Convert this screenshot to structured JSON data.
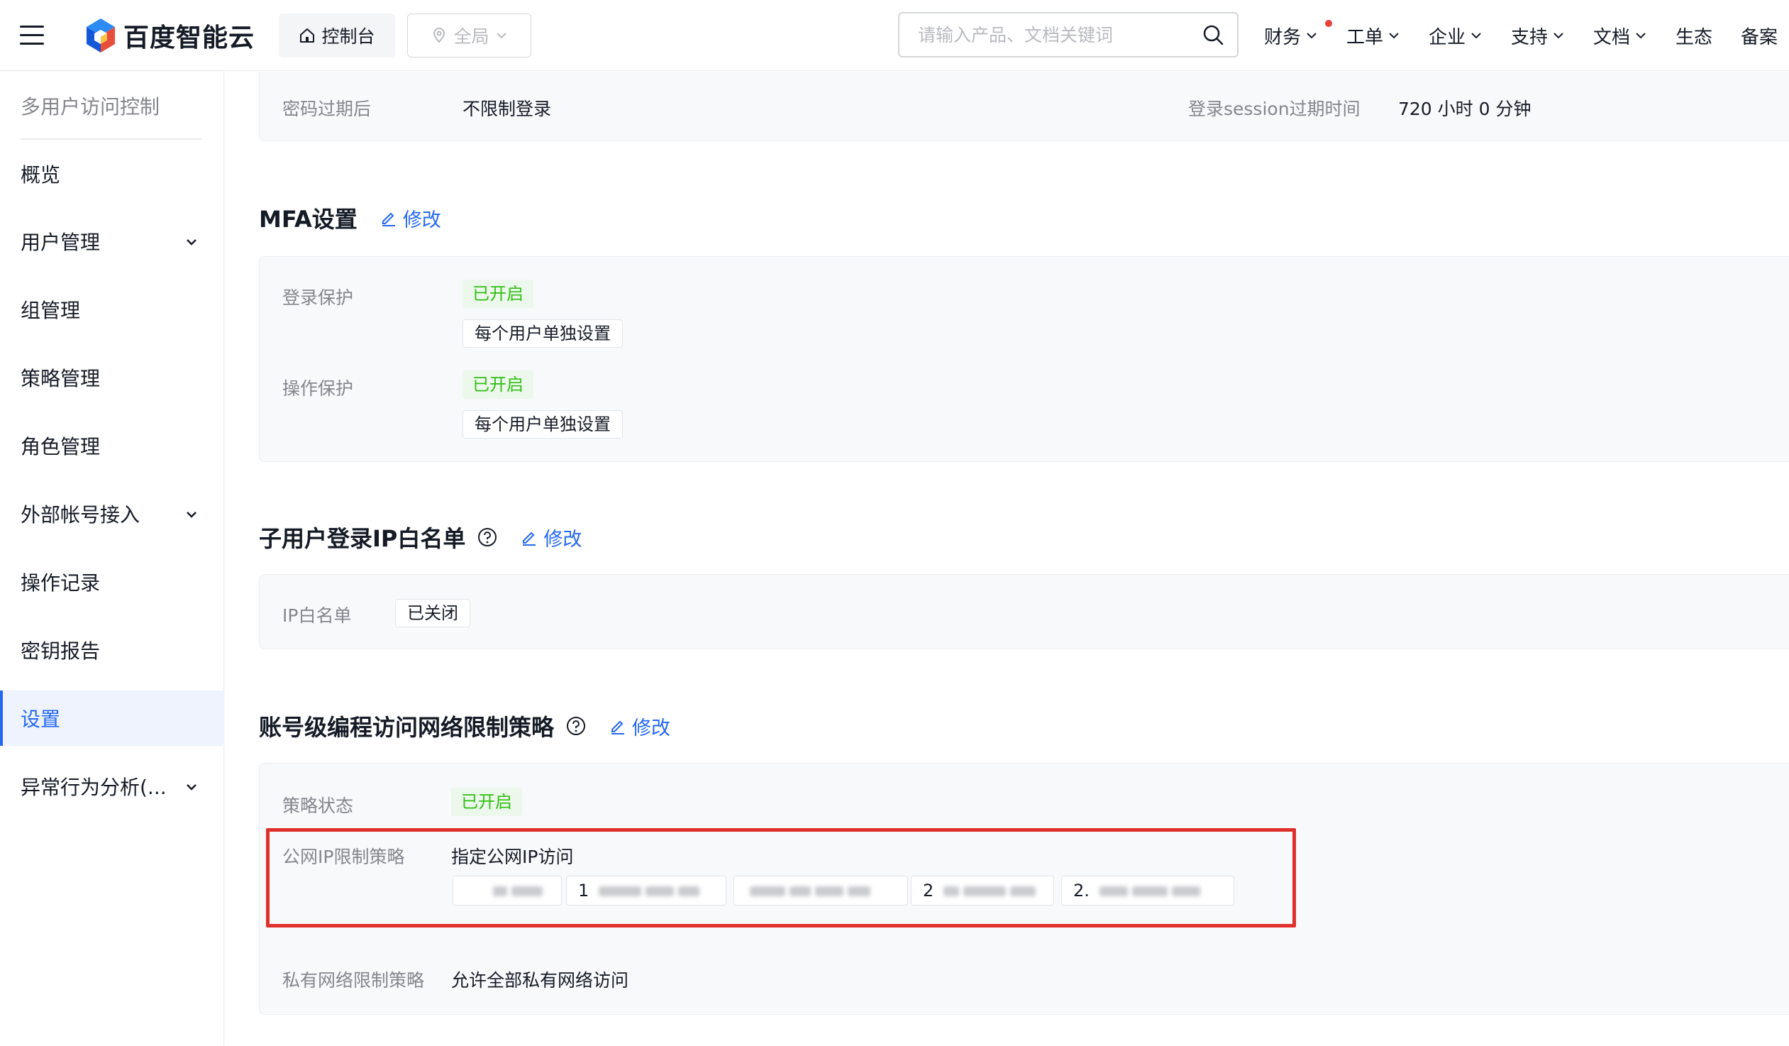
{
  "header": {
    "brand": "百度智能云",
    "console_label": "控制台",
    "region_label": "全局",
    "search_placeholder": "请输入产品、文档关键词",
    "nav": [
      "财务",
      "工单",
      "企业",
      "支持",
      "文档",
      "生态",
      "备案"
    ]
  },
  "sidebar": {
    "title": "多用户访问控制",
    "items": [
      {
        "label": "概览"
      },
      {
        "label": "用户管理"
      },
      {
        "label": "组管理"
      },
      {
        "label": "策略管理"
      },
      {
        "label": "角色管理"
      },
      {
        "label": "外部帐号接入"
      },
      {
        "label": "操作记录"
      },
      {
        "label": "密钥报告"
      },
      {
        "label": "设置"
      },
      {
        "label": "异常行为分析(..."
      }
    ]
  },
  "password": {
    "expire_label": "密码过期后",
    "expire_value": "不限制登录",
    "session_label": "登录session过期时间",
    "session_value": "720 小时 0 分钟"
  },
  "mfa": {
    "title": "MFA设置",
    "edit_label": "修改",
    "login_label": "登录保护",
    "login_status": "已开启",
    "login_mode": "每个用户单独设置",
    "op_label": "操作保护",
    "op_status": "已开启",
    "op_mode": "每个用户单独设置"
  },
  "ip_whitelist": {
    "title": "子用户登录IP白名单",
    "edit_label": "修改",
    "label": "IP白名单",
    "status": "已关闭"
  },
  "network_policy": {
    "title": "账号级编程访问网络限制策略",
    "edit_label": "修改",
    "status_label": "策略状态",
    "status": "已开启",
    "public_label": "公网IP限制策略",
    "public_value": "指定公网IP访问",
    "ip_prefixes": [
      "",
      "1",
      "",
      "2",
      "2."
    ],
    "private_label": "私有网络限制策略",
    "private_value": "允许全部私有网络访问"
  },
  "colors": {
    "accent": "#2468f2",
    "success": "#30bf13",
    "highlight": "#e0302c"
  }
}
